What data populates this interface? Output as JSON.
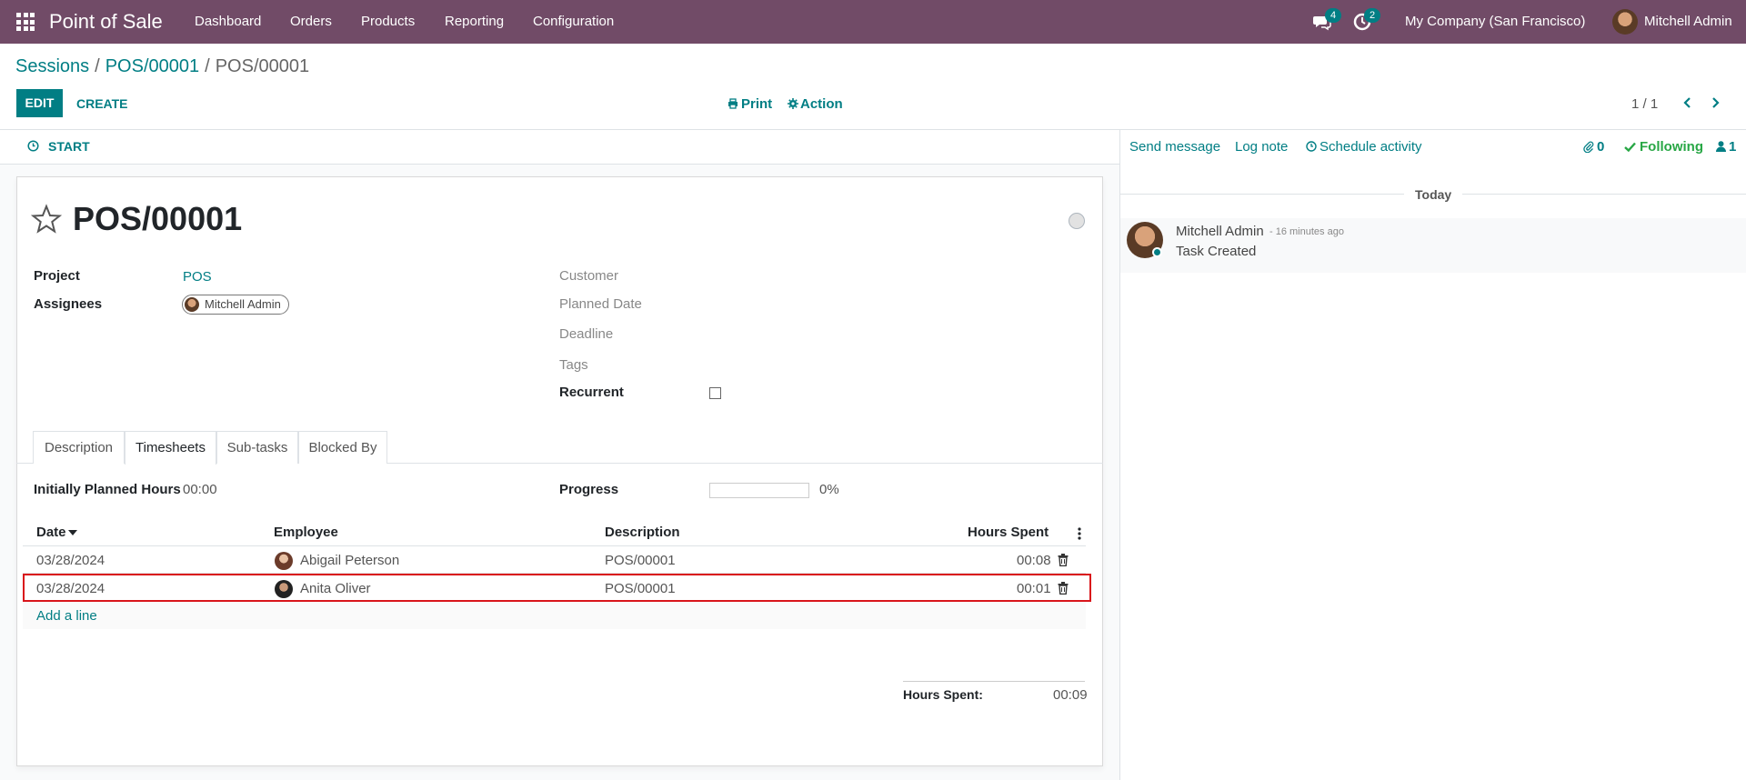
{
  "navbar": {
    "app_name": "Point of Sale",
    "menu": [
      "Dashboard",
      "Orders",
      "Products",
      "Reporting",
      "Configuration"
    ],
    "messages_badge": "4",
    "activities_badge": "2",
    "company": "My Company (San Francisco)",
    "user": "Mitchell Admin",
    "icons": {
      "apps": "grid-icon",
      "messages": "chat-icon",
      "activities": "clock-icon"
    }
  },
  "breadcrumb": {
    "items": [
      "Sessions",
      "POS/00001"
    ],
    "current": "POS/00001",
    "separator": "/"
  },
  "toolbar": {
    "edit": "EDIT",
    "create": "CREATE",
    "print": "Print",
    "action": "Action",
    "pager": "1 / 1"
  },
  "statusbar": {
    "start": "START"
  },
  "record": {
    "title": "POS/00001",
    "fields_left": {
      "project_label": "Project",
      "project_value": "POS",
      "assignees_label": "Assignees",
      "assignee": "Mitchell Admin"
    },
    "fields_right": {
      "customer_label": "Customer",
      "planned_date_label": "Planned Date",
      "deadline_label": "Deadline",
      "tags_label": "Tags",
      "recurrent_label": "Recurrent"
    }
  },
  "tabs": [
    "Description",
    "Timesheets",
    "Sub-tasks",
    "Blocked By"
  ],
  "active_tab": "Timesheets",
  "timesheets": {
    "planned_hours_label": "Initially Planned Hours",
    "planned_hours_value": "00:00",
    "progress_label": "Progress",
    "progress_value": "0%",
    "progress_fraction": 0,
    "columns": [
      "Date",
      "Employee",
      "Description",
      "Hours Spent"
    ],
    "rows": [
      {
        "date": "03/28/2024",
        "employee": "Abigail Peterson",
        "description": "POS/00001",
        "hours": "00:08"
      },
      {
        "date": "03/28/2024",
        "employee": "Anita Oliver",
        "description": "POS/00001",
        "hours": "00:01"
      }
    ],
    "add_line": "Add a line",
    "total_label": "Hours Spent:",
    "total_value": "00:09"
  },
  "chatter": {
    "send_message": "Send message",
    "log_note": "Log note",
    "schedule_activity": "Schedule activity",
    "attachments": "0",
    "following": "Following",
    "followers": "1",
    "day_separator": "Today",
    "messages": [
      {
        "author": "Mitchell Admin",
        "time": "- 16 minutes ago",
        "body": "Task Created"
      }
    ]
  },
  "colors": {
    "navbar": "#714B67",
    "accent": "#017e84",
    "highlight": "#d9151b",
    "following": "#28a745"
  }
}
